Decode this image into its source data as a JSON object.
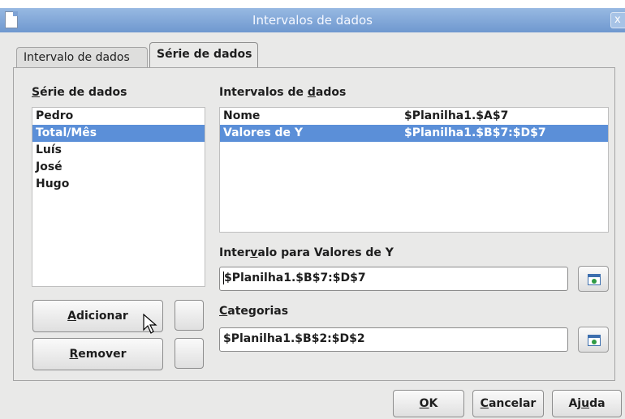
{
  "window": {
    "title": "Intervalos de dados",
    "close_label": "x"
  },
  "tabs": [
    {
      "label": "Intervalo de dados"
    },
    {
      "label": "Série de dados"
    }
  ],
  "left": {
    "heading_prefix": "",
    "heading_accel": "S",
    "heading_rest": "érie de dados",
    "series": [
      "Pedro",
      "Total/Mês",
      "Luís",
      "José",
      "Hugo"
    ],
    "selected_index": 1
  },
  "ranges": {
    "heading_prefix": "Intervalos de ",
    "heading_accel": "d",
    "heading_rest": "ados",
    "rows": [
      {
        "name": "Nome",
        "value": "$Planilha1.$A$7"
      },
      {
        "name": "Valores de Y",
        "value": "$Planilha1.$B$7:$D$7"
      }
    ],
    "selected_index": 1
  },
  "y_range": {
    "label_prefix": "Inter",
    "label_accel": "v",
    "label_rest": "alo para Valores de Y",
    "value": "$Planilha1.$B$7:$D$7"
  },
  "categories": {
    "label_prefix": "",
    "label_accel": "C",
    "label_rest": "ategorias",
    "value": "$Planilha1.$B$2:$D$2"
  },
  "buttons": {
    "add": {
      "prefix": "",
      "accel": "A",
      "rest": "dicionar"
    },
    "remove": {
      "prefix": "",
      "accel": "R",
      "rest": "emover"
    },
    "ok": {
      "prefix": "",
      "accel": "O",
      "rest": "K"
    },
    "cancel": {
      "prefix": "",
      "accel": "C",
      "rest": "ancelar"
    },
    "help": {
      "prefix": "Aj",
      "accel": "u",
      "rest": "da"
    }
  }
}
